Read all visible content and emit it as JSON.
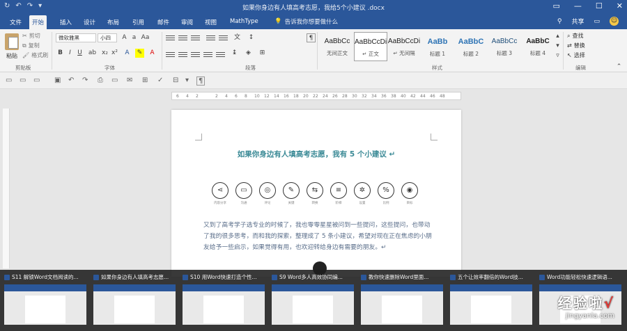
{
  "window": {
    "title": "如果你身边有人填高考志愿，我给5个小建议 .docx",
    "qat": [
      "↻",
      "↶",
      "↷",
      "▾"
    ],
    "controls": [
      "▭",
      "—",
      "☐",
      "✕"
    ]
  },
  "tabs": {
    "items": [
      "文件",
      "开始",
      "插入",
      "设计",
      "布局",
      "引用",
      "邮件",
      "审阅",
      "视图",
      "MathType"
    ],
    "tell_me": "告诉我你想要做什么",
    "share": "共享"
  },
  "ribbon": {
    "clipboard": {
      "paste": "粘贴",
      "cut": "剪切",
      "copy": "复制",
      "format_painter": "格式刷",
      "group_label": "剪贴板"
    },
    "font": {
      "name": "微软雅黑",
      "size": "小四",
      "group_label": "字体"
    },
    "paragraph": {
      "group_label": "段落"
    },
    "styles": {
      "items": [
        {
          "sample": "AaBbCc",
          "name": "无间正文"
        },
        {
          "sample": "AaBbCcDi",
          "name": "↵ 正文"
        },
        {
          "sample": "AaBbCcDi",
          "name": "↵ 无间隔"
        },
        {
          "sample": "AaBb",
          "name": "标题 1"
        },
        {
          "sample": "AaBbC",
          "name": "标题 2"
        },
        {
          "sample": "AaBbCc",
          "name": "标题 3"
        },
        {
          "sample": "AaBbC",
          "name": "标题 4"
        }
      ],
      "group_label": "样式"
    },
    "editing": {
      "find": "查找",
      "replace": "替换",
      "select": "选择",
      "group_label": "编辑"
    }
  },
  "ruler": [
    "6",
    "4",
    "2",
    "2",
    "4",
    "6",
    "8",
    "10",
    "12",
    "14",
    "16",
    "18",
    "20",
    "22",
    "24",
    "26",
    "28",
    "30",
    "32",
    "34",
    "36",
    "38",
    "40",
    "42",
    "44",
    "46",
    "48"
  ],
  "document": {
    "heading": "如果你身边有人填高考志愿，我有 5 个小建议 ↵",
    "icon_names": [
      "share-icon",
      "chat-icon",
      "comment-icon",
      "key-icon",
      "arrows-icon",
      "ladder-icon",
      "gear-icon",
      "percent-icon",
      "target-icon"
    ],
    "icon_glyphs": [
      "⋖",
      "▭",
      "◎",
      "✎",
      "⇆",
      "≡",
      "✲",
      "%",
      "◉"
    ],
    "icon_captions": [
      "内容分享",
      "沟通",
      "评论",
      "关键",
      "转换",
      "阶梯",
      "设置",
      "比例",
      "目标"
    ],
    "paragraph": "又到了高考学子选专业的时候了，我也零零星星被问到一些提问，这些提问，也带动了我的很多思考，而和我的探索，整理成了 5 条小建议，希望对现在正在焦虑的小朋友给予一些启示，如果觉得有用，也欢迎转给身边有需要的朋友。↵"
  },
  "taskbar": {
    "thumbnails": [
      "S11 解锁Word文档阅读的...",
      "如果你身边有人填高考志愿...",
      "S10 用Word快速打造个性...",
      "S9 Word多人高效协同编...",
      "教你快速删除Word里面...",
      "五个让效率翻倍的Word技...",
      "Word功能轻松快速逻辑语..."
    ]
  },
  "watermark": {
    "brand": "经验啦",
    "check": "√",
    "url": "jingyanla.com"
  }
}
